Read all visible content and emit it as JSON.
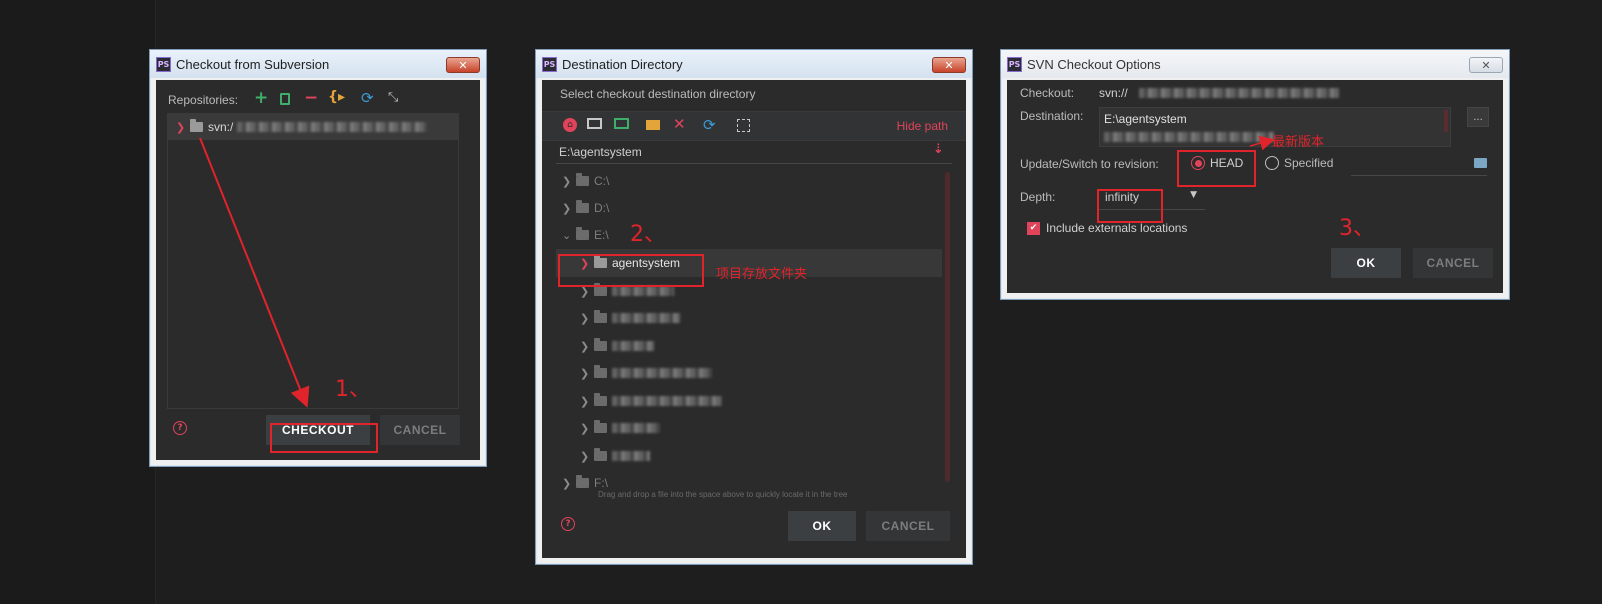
{
  "dialog1": {
    "title": "Checkout from Subversion",
    "repositories_label": "Repositories:",
    "repo_item": "svn:/",
    "checkout_button": "CHECKOUT",
    "cancel_button": "CANCEL",
    "annotation": "1、"
  },
  "dialog2": {
    "title": "Destination Directory",
    "subtitle": "Select checkout destination directory",
    "hide_path": "Hide path",
    "path_value": "E:\\agentsystem",
    "drives": {
      "c": "C:\\",
      "d": "D:\\",
      "e": "E:\\",
      "f": "F:\\"
    },
    "selected_folder": "agentsystem",
    "hint": "Drag and drop a file into the space above to quickly locate it in the tree",
    "ok_button": "OK",
    "cancel_button": "CANCEL",
    "annotation": "2、",
    "annotation_text": "项目存放文件夹"
  },
  "dialog3": {
    "title": "SVN Checkout Options",
    "checkout_label": "Checkout:",
    "checkout_value": "svn://",
    "destination_label": "Destination:",
    "destination_value": "E:\\agentsystem",
    "revision_label": "Update/Switch to revision:",
    "head_option": "HEAD",
    "specified_option": "Specified",
    "depth_label": "Depth:",
    "depth_value": "infinity",
    "include_externals": "Include externals locations",
    "ok_button": "OK",
    "cancel_button": "CANCEL",
    "annotation": "3、",
    "annotation_text": "最新版本"
  },
  "colors": {
    "accent_red": "#e0242b",
    "toolbar_green": "#3fae6b",
    "toolbar_red": "#e0445a",
    "toolbar_orange": "#e3a53a"
  }
}
